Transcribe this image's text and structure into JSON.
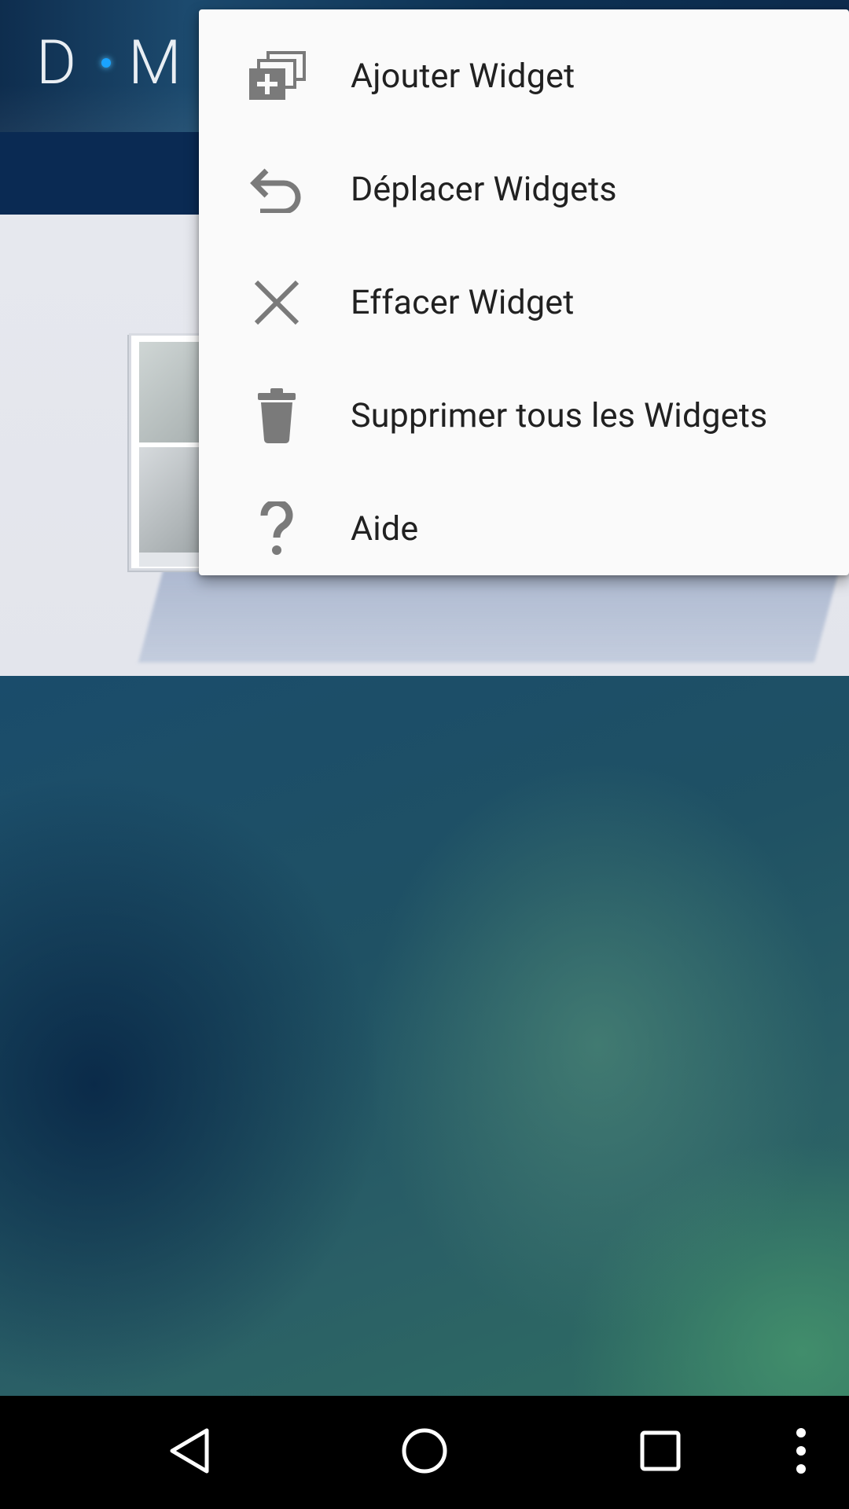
{
  "app": {
    "logo_text_left": "D",
    "logo_text_right": "M"
  },
  "menu": {
    "items": [
      {
        "label": "Ajouter Widget",
        "icon": "add-widget-icon"
      },
      {
        "label": "Déplacer Widgets",
        "icon": "undo-arrow-icon"
      },
      {
        "label": "Effacer Widget",
        "icon": "close-icon"
      },
      {
        "label": "Supprimer tous les Widgets",
        "icon": "trash-icon"
      },
      {
        "label": "Aide",
        "icon": "help-icon"
      }
    ]
  },
  "navbar": {
    "buttons": [
      "back-icon",
      "home-icon",
      "recents-icon",
      "overflow-menu-icon"
    ]
  },
  "colors": {
    "menu_bg": "#fafafa",
    "menu_text": "#212121",
    "icon_gray": "#7a7a7a",
    "navbar": "#000000",
    "accent_dot": "#1aa3ff"
  }
}
